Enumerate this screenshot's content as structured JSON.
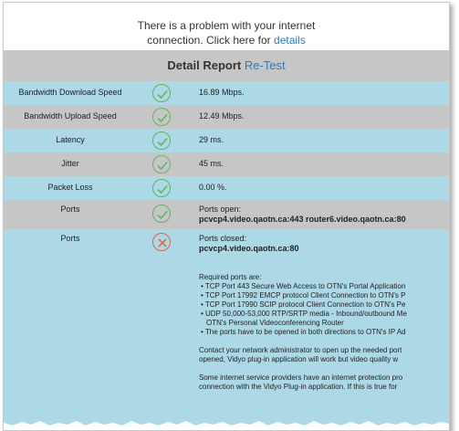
{
  "banner": {
    "line1": "There is a problem with your internet",
    "line2_prefix": "connection. Click here for ",
    "details_link": "details"
  },
  "report": {
    "title": "Detail Report",
    "retest_link": "Re-Test"
  },
  "rows": [
    {
      "label": "Bandwidth Download Speed",
      "status": "ok",
      "value": "16.89 Mbps."
    },
    {
      "label": "Bandwidth Upload Speed",
      "status": "ok",
      "value": "12.49 Mbps."
    },
    {
      "label": "Latency",
      "status": "ok",
      "value": "29 ms."
    },
    {
      "label": "Jitter",
      "status": "ok",
      "value": "45 ms."
    },
    {
      "label": "Packet Loss",
      "status": "ok",
      "value": "0.00 %."
    },
    {
      "label": "Ports",
      "status": "ok",
      "value": "Ports open:",
      "value2": "pcvcp4.video.qaotn.ca:443 router6.video.qaotn.ca:80"
    },
    {
      "label": "Ports",
      "status": "error",
      "value": "Ports closed:",
      "value2": "pcvcp4.video.qaotn.ca:80"
    }
  ],
  "ports_details": {
    "required_heading": "Required ports are:",
    "bullets": [
      "TCP Port 443 Secure Web Access to OTN's Portal Application",
      "TCP Port 17992 EMCP protocol Client Connection to OTN's P",
      "TCP Port 17990 SCIP protocol Client Connection to OTN's Pe",
      "UDP 50,000-53,000 RTP/SRTP media - Inbound/outbound Me",
      "OTN's Personal Videoconferencing Router",
      "The ports have to be opened in both directions to OTN's IP Ad"
    ],
    "contact_line1": "Contact your network administrator to open up the needed port",
    "contact_line2": "opened, Vidyo plug-in application will work but video quality w",
    "provider_line1": "Some internet service providers have an internet protection pro",
    "provider_line2": "connection with the Vidyo Plug-in application. If this is true for"
  },
  "colors": {
    "row_blue": "#add8e6",
    "row_gray": "#c6c6c6",
    "link": "#2b7bbf",
    "ok": "#5cb85c",
    "error": "#e0643a"
  }
}
